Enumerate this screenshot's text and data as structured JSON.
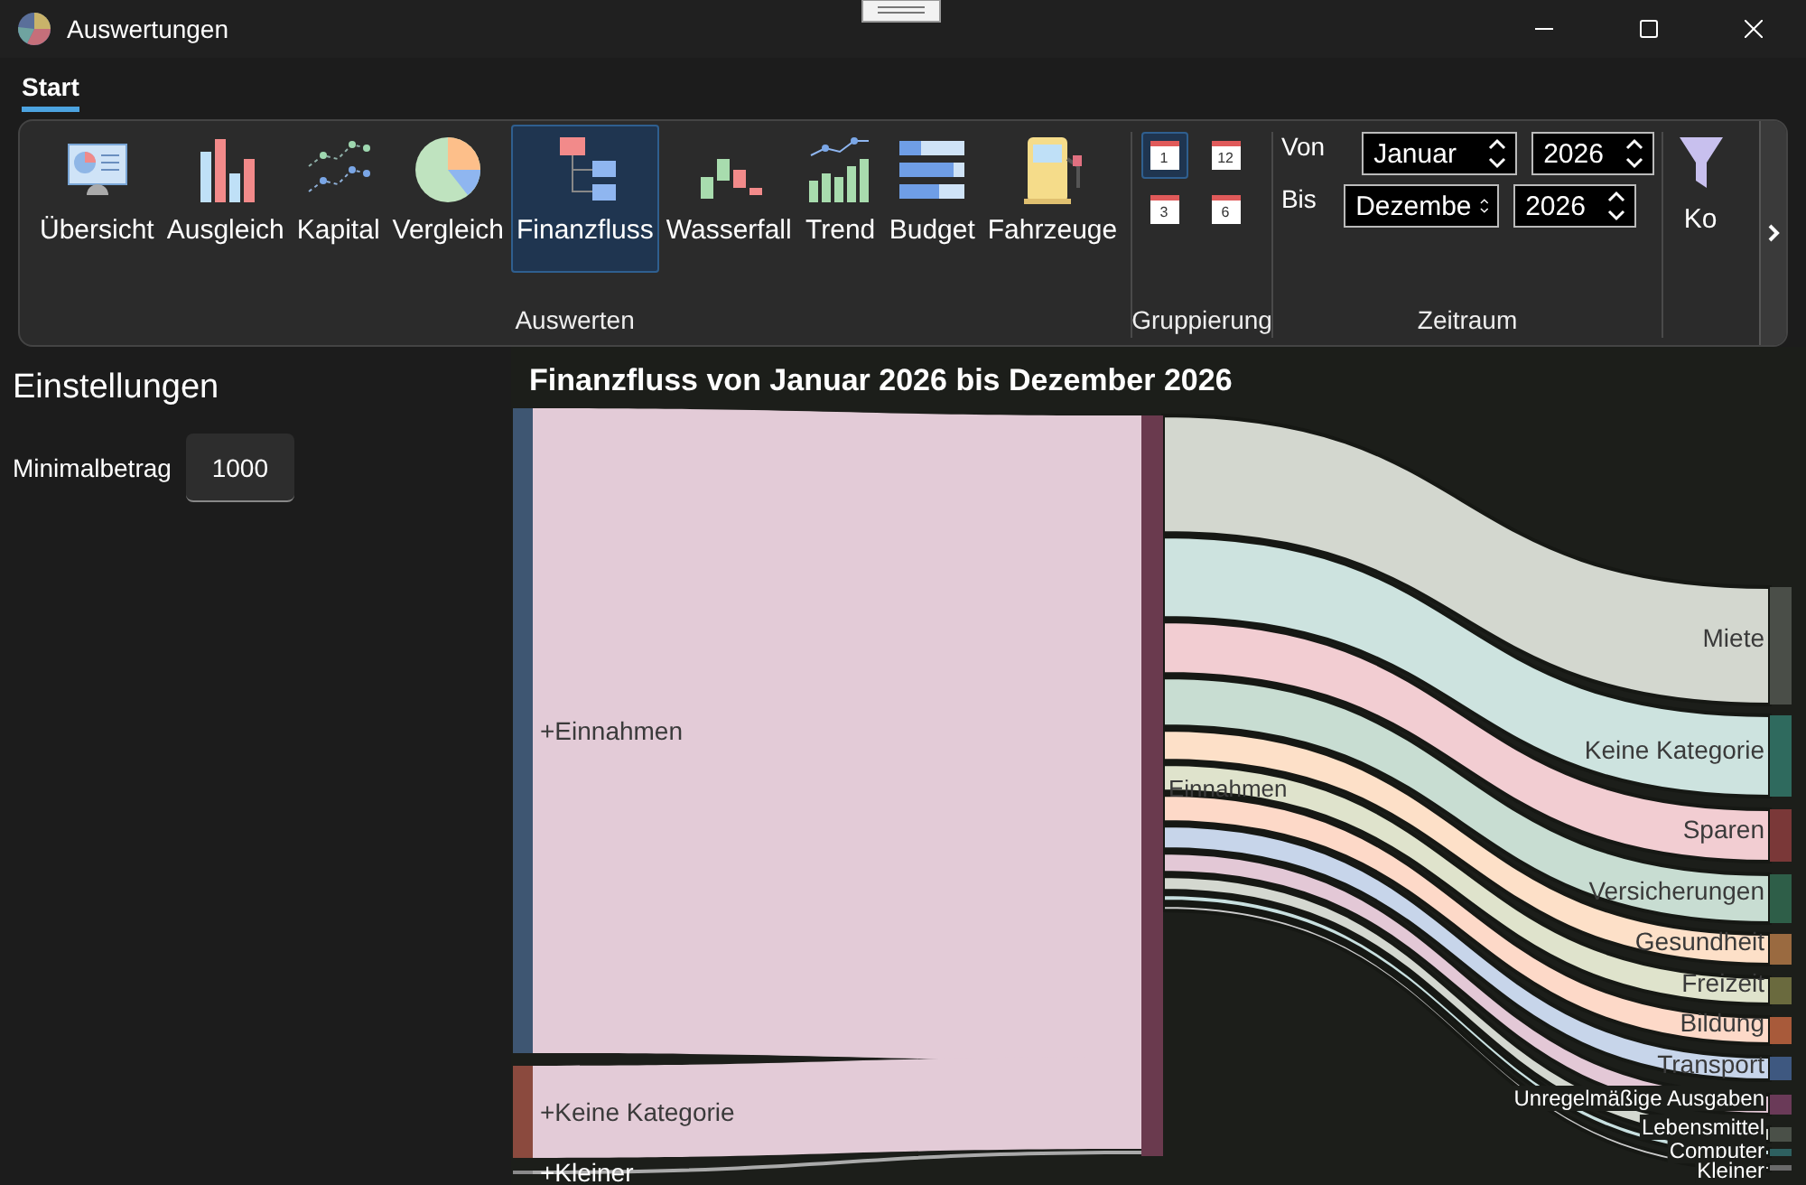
{
  "window": {
    "title": "Auswertungen"
  },
  "tabs": [
    {
      "label": "Start",
      "selected": true
    }
  ],
  "ribbon": {
    "groups": [
      {
        "label": "Auswerten",
        "kind": "buttons",
        "buttons": [
          {
            "label": "Übersicht",
            "selected": false
          },
          {
            "label": "Ausgleich",
            "selected": false
          },
          {
            "label": "Kapital",
            "selected": false
          },
          {
            "label": "Vergleich",
            "selected": false
          },
          {
            "label": "Finanzfluss",
            "selected": true
          },
          {
            "label": "Wasserfall",
            "selected": false
          },
          {
            "label": "Trend",
            "selected": false
          },
          {
            "label": "Budget",
            "selected": false
          },
          {
            "label": "Fahrzeuge",
            "selected": false
          }
        ]
      },
      {
        "label": "Gruppierung",
        "kind": "grouping",
        "options": [
          {
            "label": "1",
            "selected": true
          },
          {
            "label": "12",
            "selected": false
          },
          {
            "label": "3",
            "selected": false
          },
          {
            "label": "6",
            "selected": false
          }
        ]
      },
      {
        "label": "Zeitraum",
        "kind": "range",
        "rows": [
          {
            "label": "Von",
            "month": "Januar",
            "year": "2026"
          },
          {
            "label": "Bis",
            "month": "Dezembe",
            "year": "2026"
          }
        ]
      }
    ],
    "overflow_button": {
      "label": "Ko"
    }
  },
  "settings": {
    "title": "Einstellungen",
    "fields": [
      {
        "label": "Minimalbetrag",
        "value": "1000"
      }
    ]
  },
  "chart": {
    "title": "Finanzfluss von Januar 2026 bis Dezember 2026",
    "sources": [
      {
        "label": "+Einnahmen",
        "color": "#3e5672"
      },
      {
        "label": "+Keine Kategorie",
        "color": "#8b4a3e"
      },
      {
        "label": "+Kleiner",
        "color": "#8a8a8a"
      }
    ],
    "center": {
      "label": "Einnahmen",
      "color": "#6a3a4e"
    },
    "targets": [
      {
        "label": "Miete",
        "color": "#4a4e48"
      },
      {
        "label": "Keine Kategorie",
        "color": "#2f6a5e"
      },
      {
        "label": "Sparen",
        "color": "#7a3838"
      },
      {
        "label": "Versicherungen",
        "color": "#2e5e48"
      },
      {
        "label": "Gesundheit",
        "color": "#9a6a40"
      },
      {
        "label": "Freizeit",
        "color": "#6a6a3e"
      },
      {
        "label": "Bildung",
        "color": "#a85a3a"
      },
      {
        "label": "Transport",
        "color": "#3e5880"
      },
      {
        "label": "Unregelmäßige Ausgaben",
        "color": "#6a3a58"
      },
      {
        "label": "Lebensmittel",
        "color": "#4a5048"
      },
      {
        "label": "Computer",
        "color": "#2e6060"
      },
      {
        "label": "Kleiner",
        "color": "#6a6a6a"
      }
    ]
  }
}
